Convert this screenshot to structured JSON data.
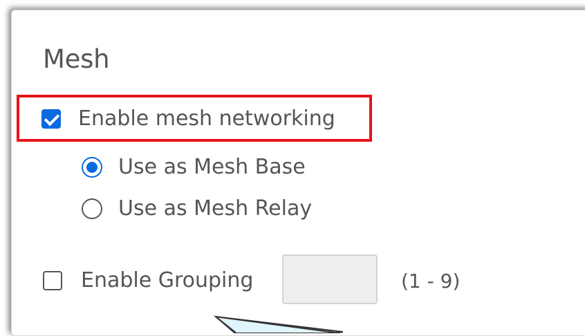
{
  "section": {
    "title": "Mesh"
  },
  "mesh": {
    "enable_label": "Enable mesh networking",
    "enabled": true,
    "mode_options": [
      {
        "label": "Use as Mesh Base",
        "selected": true
      },
      {
        "label": "Use as Mesh Relay",
        "selected": false
      }
    ]
  },
  "grouping": {
    "enable_label": "Enable Grouping",
    "enabled": false,
    "value": "",
    "range_hint": "(1 - 9)"
  },
  "colors": {
    "accent": "#0a6ae0",
    "highlight_border": "#e8131b",
    "callout_fill": "#dff4fb",
    "text": "#555555"
  },
  "icons": {
    "checkbox_checked": "checkbox-checked-icon",
    "checkbox_unchecked": "checkbox-unchecked-icon",
    "radio_selected": "radio-selected-icon",
    "radio_unselected": "radio-unselected-icon"
  }
}
